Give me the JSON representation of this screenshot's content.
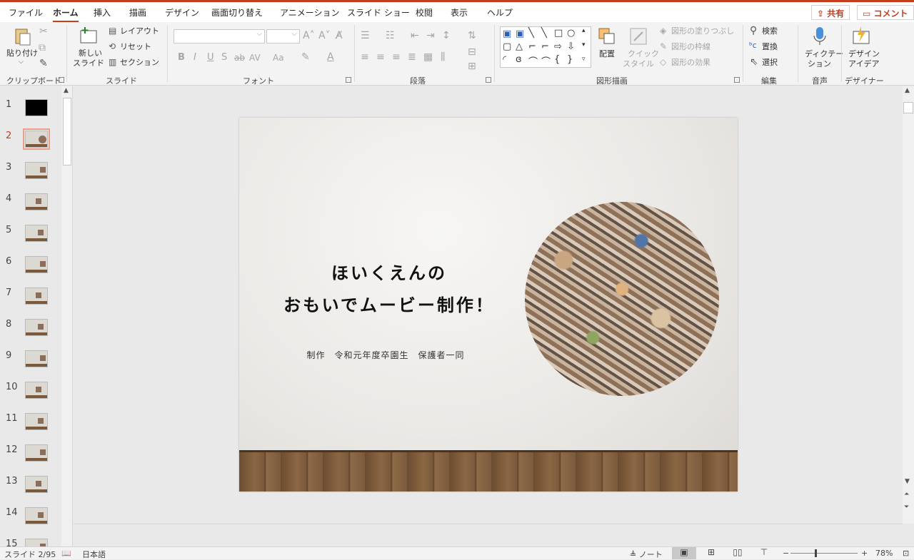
{
  "menu": {
    "tabs": [
      "ファイル",
      "ホーム",
      "挿入",
      "描画",
      "デザイン",
      "画面切り替え",
      "アニメーション",
      "スライド ショー",
      "校閲",
      "表示",
      "ヘルプ"
    ],
    "active_tab": "ホーム",
    "share_label": "共有",
    "comment_label": "コメント"
  },
  "ribbon": {
    "clipboard": {
      "paste": "貼り付け",
      "group": "クリップボード"
    },
    "slides": {
      "new_slide_line1": "新しい",
      "new_slide_line2": "スライド",
      "layout": "レイアウト",
      "reset": "リセット",
      "section": "セクション",
      "group": "スライド"
    },
    "font": {
      "group": "フォント",
      "bold": "B",
      "italic": "I",
      "underline": "U",
      "shadow": "S",
      "strike": "ab",
      "spacing": "AV",
      "case": "Aa"
    },
    "paragraph": {
      "group": "段落"
    },
    "drawing": {
      "arrange": "配置",
      "quick_line1": "クイック",
      "quick_line2": "スタイル",
      "fill": "図形の塗りつぶし",
      "outline": "図形の枠線",
      "effect": "図形の効果",
      "group": "図形描画"
    },
    "editing": {
      "find": "検索",
      "replace": "置換",
      "select": "選択",
      "group": "編集"
    },
    "voice": {
      "dictate_line1": "ディクテー",
      "dictate_line2": "ション",
      "group": "音声"
    },
    "designer": {
      "ideas_line1": "デザイン",
      "ideas_line2": "アイデア",
      "group": "デザイナー"
    }
  },
  "thumbnails": {
    "numbers": [
      "1",
      "2",
      "3",
      "4",
      "5",
      "6",
      "7",
      "8",
      "9",
      "10",
      "11",
      "12",
      "13",
      "14",
      "15"
    ],
    "selected": "2"
  },
  "slide": {
    "title_line1": "ほいくえんの",
    "title_line2": "おもいでムービー制作！",
    "subtitle": "制作　令和元年度卒園生　保護者一同"
  },
  "status": {
    "slide_indicator": "スライド 2/95",
    "language": "日本語",
    "notes": "ノート",
    "zoom": "78%"
  },
  "colors": {
    "accent": "#c43e1c",
    "ribbon_bg": "#f3f3f3",
    "workspace_bg": "#e9e9e9"
  }
}
